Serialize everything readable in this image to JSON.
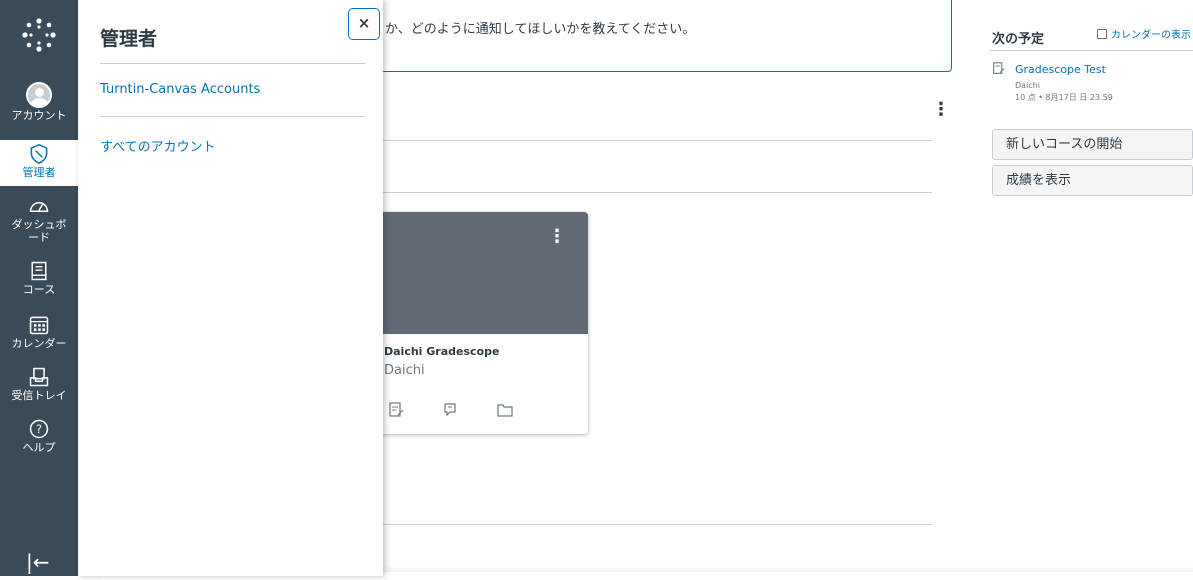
{
  "global_nav": {
    "items": [
      {
        "label": "アカウント",
        "icon": "avatar"
      },
      {
        "label": "管理者",
        "icon": "shield-icon",
        "active": true
      },
      {
        "label": "ダッシュボード",
        "icon": "dashboard-icon"
      },
      {
        "label": "コース",
        "icon": "book-icon"
      },
      {
        "label": "カレンダー",
        "icon": "calendar-icon"
      },
      {
        "label": "受信トレイ",
        "icon": "inbox-icon"
      },
      {
        "label": "ヘルプ",
        "icon": "help-icon"
      }
    ],
    "collapse_glyph": "|←"
  },
  "tray": {
    "title": "管理者",
    "links": [
      "Turntin-Canvas Accounts",
      "すべてのアカウント"
    ],
    "close_glyph": "×"
  },
  "notice": {
    "text": "か、どのように通知してほしいかを教えてください。"
  },
  "course_card": {
    "title": "Daichi Gradescope",
    "subtitle": "Daichi",
    "hero_color": "#616b75"
  },
  "sidebar": {
    "title": "次の予定",
    "calendar_link": "カレンダーの表示",
    "todo": {
      "name": "Gradescope Test",
      "course": "Daichi",
      "meta": "10 点 • 8月17日 日 23.59"
    },
    "buttons": [
      "新しいコースの開始",
      "成績を表示"
    ]
  },
  "colors": {
    "nav_bg": "#394b58",
    "accent": "#0374b5",
    "text": "#2d3b45"
  }
}
